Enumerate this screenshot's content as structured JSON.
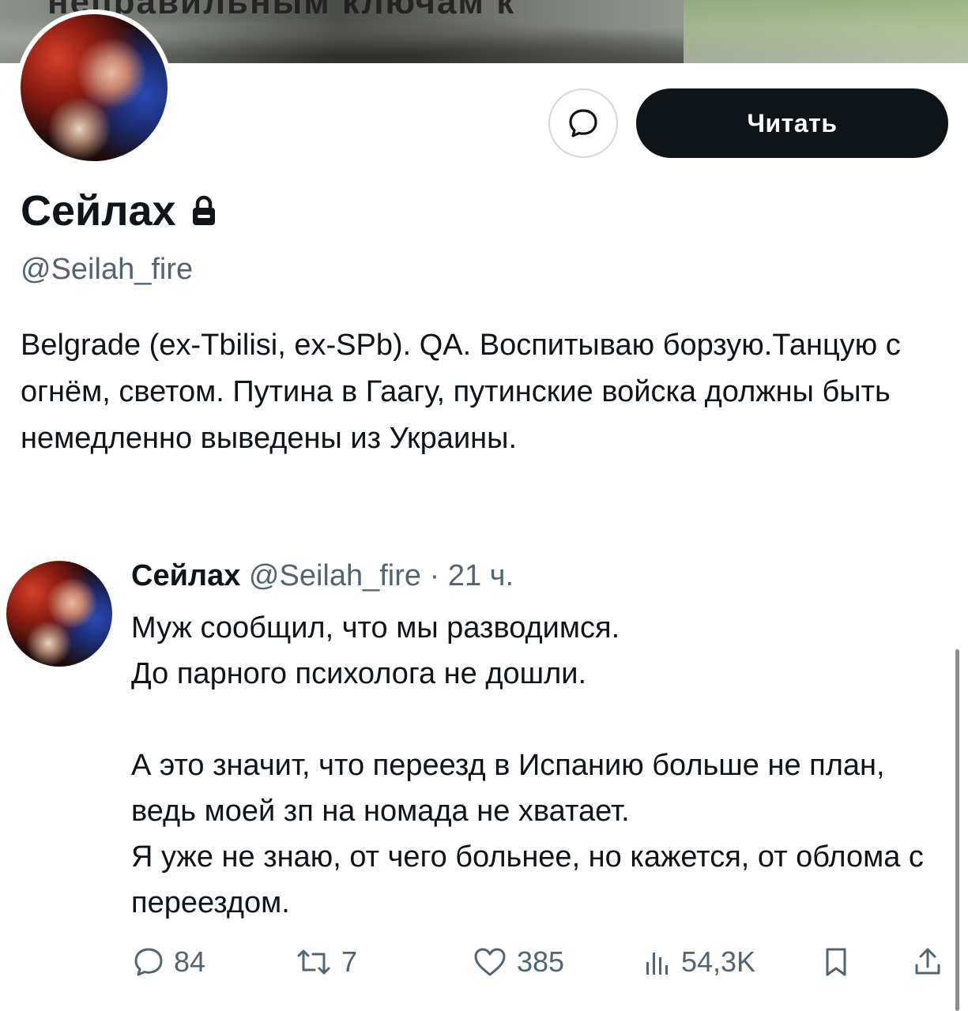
{
  "banner": {
    "overlay_text": "неправильным ключам к"
  },
  "profile": {
    "display_name": "Сейлах",
    "handle": "@Seilah_fire",
    "bio": "Belgrade (ex-Tbilisi, ex-SPb). QA. Воспитываю борзую.Танцую с огнём, светом. Путина в Гаагу, путинские войска должны быть немедленно выведены из Украины.",
    "follow_label": "Читать",
    "icons": {
      "lock": "lock-icon",
      "message": "message-icon"
    }
  },
  "tweet": {
    "author_name": "Сейлах",
    "author_handle": "@Seilah_fire",
    "separator": "·",
    "time": "21 ч.",
    "paragraph1_line1": "Муж сообщил, что мы разводимся.",
    "paragraph1_line2": "До парного психолога не дошли.",
    "paragraph2": "А это значит, что переезд в Испанию больше не план, ведь моей зп на номада не хватает.",
    "paragraph3": "Я уже не знаю, от чего больнее, но кажется, от облома с переездом.",
    "stats": {
      "replies": "84",
      "reposts": "7",
      "likes": "385",
      "views": "54,3K"
    }
  }
}
